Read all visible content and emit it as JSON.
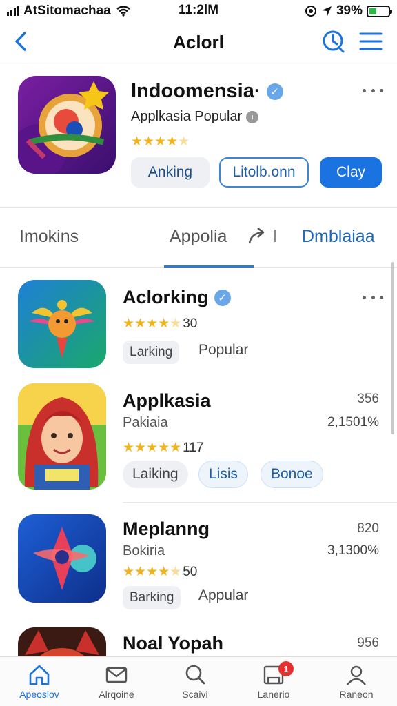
{
  "status_bar": {
    "carrier": "AtSitomachaa",
    "time": "11:2lM",
    "battery": "39%",
    "battery_level": 0.39
  },
  "nav": {
    "title": "Aclorl"
  },
  "featured": {
    "name": "Indoomensia·",
    "subtitle": "Applkasia Popular",
    "rating": 4.5,
    "buttons": {
      "secondary": "Anking",
      "outline": "Litolb.onn",
      "primary": "Clay"
    }
  },
  "tabs": {
    "left": "Imokins",
    "middle": "Appolia",
    "right": "Dmblaiaa"
  },
  "list": [
    {
      "name": "Aclorking",
      "verified": true,
      "rating": 4.5,
      "rating_count": "30",
      "chip": "Larking",
      "chip_text": "Popular"
    },
    {
      "name": "Applkasia",
      "subtitle": "Pakiaia",
      "number": "356",
      "percent": "2,1501%",
      "rating": 5,
      "rating_count": "117",
      "chips": [
        "Laiking",
        "Lisis",
        "Bonoe"
      ]
    },
    {
      "name": "Meplanng",
      "subtitle": "Bokiria",
      "number": "820",
      "percent": "3,1300%",
      "rating": 4.5,
      "rating_count": "50",
      "chip": "Barking",
      "chip_text": "Appular"
    },
    {
      "name": "Noal Yopah",
      "number": "956"
    }
  ],
  "tab_bar": [
    {
      "label": "Apeoslov",
      "icon": "home-icon",
      "active": true
    },
    {
      "label": "Alrqoine",
      "icon": "mail-icon",
      "active": false
    },
    {
      "label": "Scaivi",
      "icon": "search-icon",
      "active": false
    },
    {
      "label": "Lanerio",
      "icon": "updates-icon",
      "active": false,
      "badge": "1"
    },
    {
      "label": "Raneon",
      "icon": "profile-icon",
      "active": false
    }
  ],
  "colors": {
    "accent": "#1a73e0",
    "star": "#f1b31c",
    "badge": "#e53030"
  }
}
